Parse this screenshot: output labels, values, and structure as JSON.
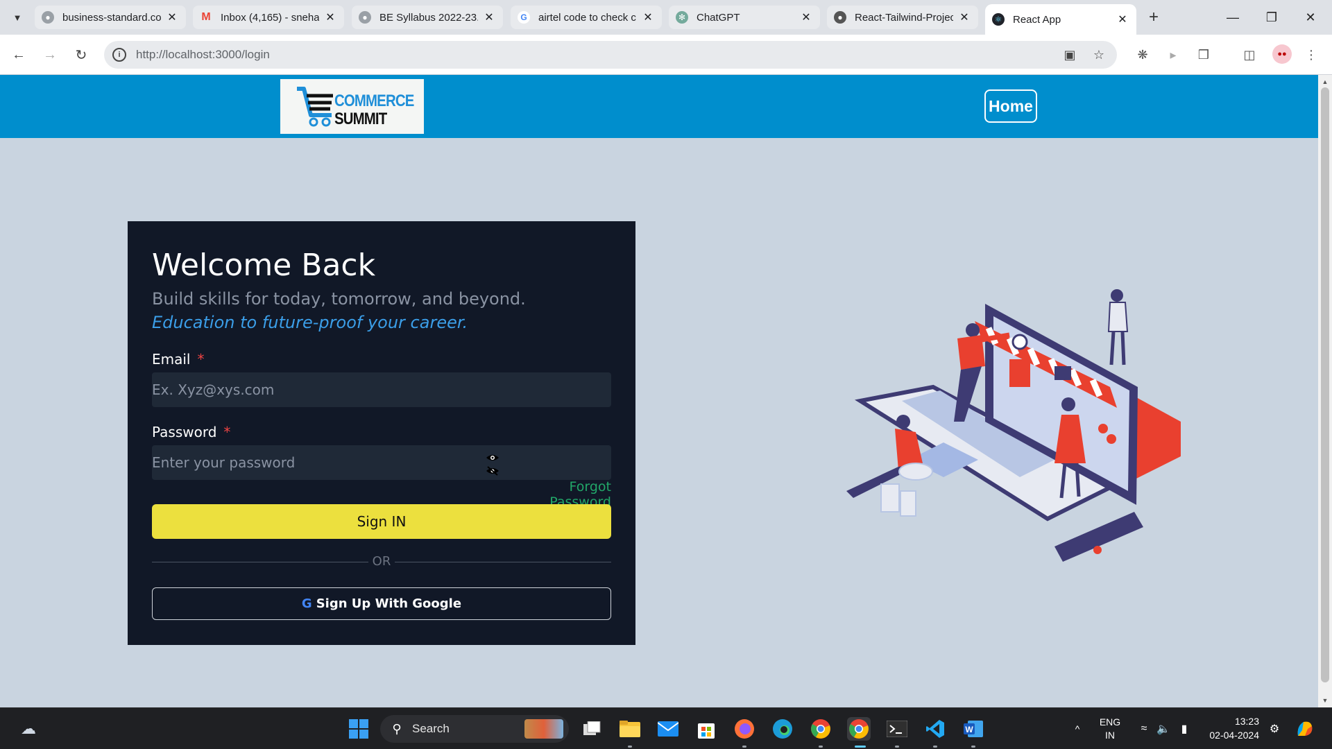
{
  "browser": {
    "tabs": [
      {
        "title": "business-standard.co",
        "favicon": "globe-icon"
      },
      {
        "title": "Inbox (4,165) - sneha",
        "favicon": "gmail-icon"
      },
      {
        "title": "BE Syllabus 2022-23.",
        "favicon": "globe-icon"
      },
      {
        "title": "airtel code to check c",
        "favicon": "google-icon"
      },
      {
        "title": "ChatGPT",
        "favicon": "chatgpt-icon"
      },
      {
        "title": "React-Tailwind-Projec",
        "favicon": "github-icon"
      },
      {
        "title": "React App",
        "favicon": "react-icon",
        "active": true
      }
    ],
    "url": "http://localhost:3000/login"
  },
  "site": {
    "logo": {
      "line1": "COMMERCE",
      "line2": "SUMMIT"
    },
    "nav": {
      "home_label": "Home"
    }
  },
  "login": {
    "heading": "Welcome Back",
    "subtitle": "Build skills for today, tomorrow, and beyond.",
    "tagline": "Education to future-proof your career.",
    "email_label": "Email",
    "email_placeholder": "Ex. Xyz@xys.com",
    "required_mark": "*",
    "password_label": "Password",
    "password_placeholder": "Enter your password",
    "forgot_label": "Forgot Password",
    "signin_label": "Sign IN",
    "or_label": "OR",
    "google_label": "Sign Up With Google"
  },
  "taskbar": {
    "search_label": "Search",
    "lang_line1": "ENG",
    "lang_line2": "IN",
    "time": "13:23",
    "date": "02-04-2024"
  },
  "colors": {
    "header_bg": "#008ecd",
    "card_bg": "#111827",
    "signin_bg": "#ece03e",
    "forgot": "#22a769",
    "tagline": "#3b9ee8"
  }
}
